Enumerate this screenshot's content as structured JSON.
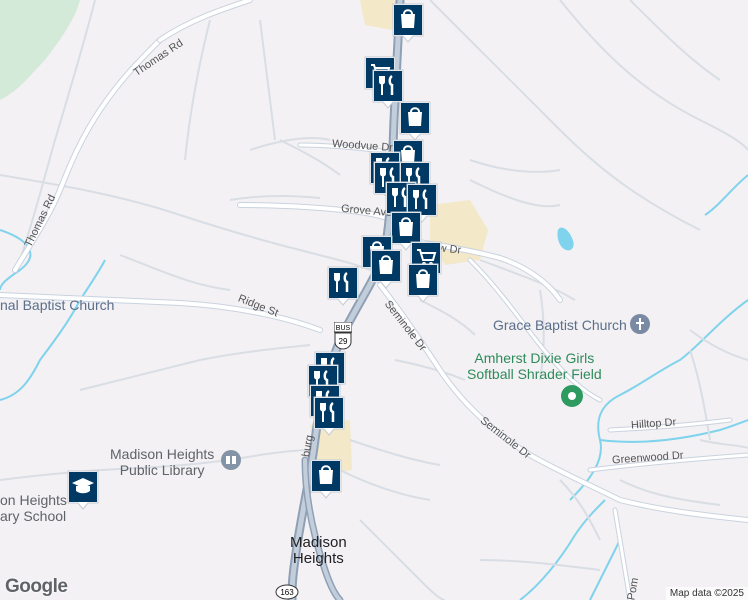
{
  "map": {
    "roads": [
      {
        "id": "thomas-rd-n",
        "label": "Thomas Rd"
      },
      {
        "id": "thomas-rd-w",
        "label": "Thomas Rd"
      },
      {
        "id": "woodvue",
        "label": "Woodvue Dr"
      },
      {
        "id": "grove",
        "label": "Grove Ave"
      },
      {
        "id": "view",
        "label": "iew Dr"
      },
      {
        "id": "ridge",
        "label": "Ridge St"
      },
      {
        "id": "seminole1",
        "label": "Seminole Dr"
      },
      {
        "id": "seminole2",
        "label": "Seminole Dr"
      },
      {
        "id": "hilltop",
        "label": "Hilltop Dr"
      },
      {
        "id": "greenwood",
        "label": "Greenwood Dr"
      },
      {
        "id": "lynchburg",
        "label": "burg"
      },
      {
        "id": "pom",
        "label": "Pom"
      }
    ],
    "pois": [
      {
        "id": "grace-baptist",
        "label": "Grace Baptist Church"
      },
      {
        "id": "baptist-west",
        "label": "nal Baptist Church"
      },
      {
        "id": "softball",
        "label": "Amherst Dixie Girls\nSoftball Shrader Field"
      },
      {
        "id": "library",
        "label": "Madison Heights\nPublic Library"
      },
      {
        "id": "school",
        "label": "on Heights\nary School"
      }
    ],
    "town": {
      "label": "Madison\nHeights"
    },
    "shields": [
      {
        "id": "bus29",
        "top": "BUS",
        "num": "29"
      },
      {
        "id": "r163",
        "num": "163"
      }
    ],
    "markers": [
      {
        "id": "m1",
        "icon": "shopping-bag"
      },
      {
        "id": "m2",
        "icon": "shopping-cart"
      },
      {
        "id": "m3",
        "icon": "restaurant"
      },
      {
        "id": "m4",
        "icon": "shopping-bag"
      },
      {
        "id": "m5",
        "icon": "shopping-bag"
      },
      {
        "id": "m6",
        "icon": "restaurant"
      },
      {
        "id": "m7",
        "icon": "restaurant"
      },
      {
        "id": "m8",
        "icon": "restaurant"
      },
      {
        "id": "m9",
        "icon": "restaurant"
      },
      {
        "id": "m10",
        "icon": "restaurant"
      },
      {
        "id": "m11",
        "icon": "shopping-bag"
      },
      {
        "id": "m12",
        "icon": "shopping-bag"
      },
      {
        "id": "m13",
        "icon": "shopping-cart"
      },
      {
        "id": "m14",
        "icon": "shopping-bag"
      },
      {
        "id": "m15",
        "icon": "shopping-bag"
      },
      {
        "id": "m16",
        "icon": "restaurant"
      },
      {
        "id": "m17",
        "icon": "restaurant"
      },
      {
        "id": "m18",
        "icon": "restaurant"
      },
      {
        "id": "m19",
        "icon": "restaurant"
      },
      {
        "id": "m20",
        "icon": "restaurant"
      },
      {
        "id": "m21",
        "icon": "shopping-bag"
      },
      {
        "id": "m22",
        "icon": "school"
      }
    ],
    "attribution": "Map data ©2025",
    "logo": "Google",
    "colors": {
      "background": "#f3f1f4",
      "road": "#ffffff",
      "road_border": "#c9d3de",
      "water": "#7fd3ec",
      "park": "#d4ead8",
      "marker": "#003a64",
      "highway": "#8fa0b6"
    }
  }
}
